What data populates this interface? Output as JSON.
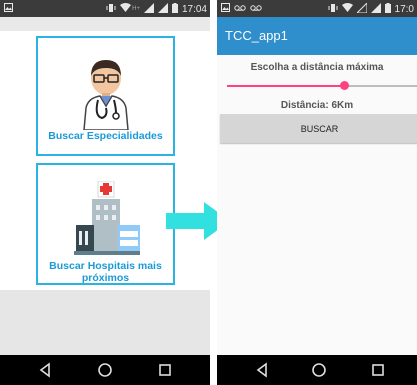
{
  "left_phone": {
    "status": {
      "time": "17:04",
      "network": "H+"
    },
    "cards": [
      {
        "label": "Buscar Especialidades"
      },
      {
        "label": "Buscar Hospitais mais próximos"
      }
    ]
  },
  "right_phone": {
    "status": {
      "time": "17:0"
    },
    "app_title": "TCC_app1",
    "heading": "Escolha a distância máxima",
    "distance_text": "Distância: 6Km",
    "slider_fraction": 0.62,
    "button_label": "BUSCAR"
  },
  "colors": {
    "accent": "#2bb3e3",
    "app_bar": "#2e8fcc",
    "slider": "#ff4081",
    "arrow": "#33e0e0"
  },
  "icons": [
    "doctor-icon",
    "hospital-icon",
    "back-icon",
    "home-icon",
    "recents-icon",
    "wifi-icon",
    "signal-icon",
    "battery-icon"
  ]
}
